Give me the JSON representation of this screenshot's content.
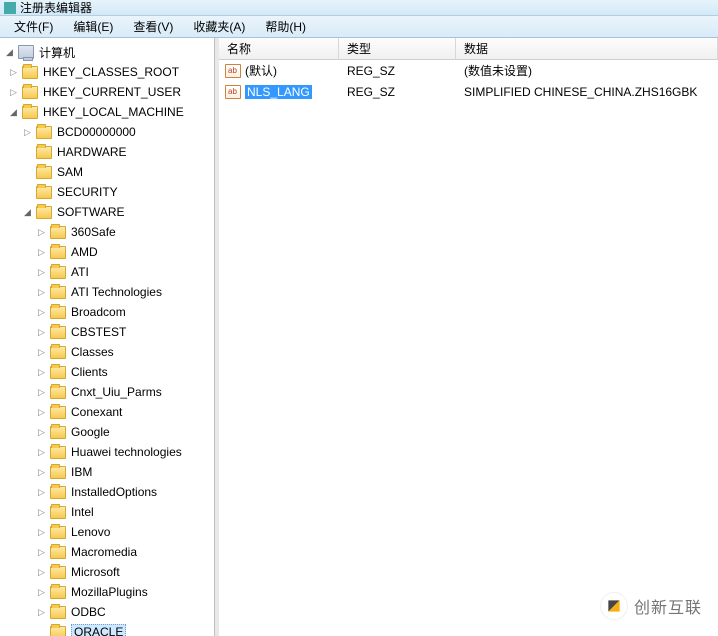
{
  "window": {
    "title": "注册表编辑器"
  },
  "menu": {
    "file": "文件(F)",
    "edit": "编辑(E)",
    "view": "查看(V)",
    "favorites": "收藏夹(A)",
    "help": "帮助(H)"
  },
  "tree": {
    "root": "计算机",
    "hives": [
      {
        "name": "HKEY_CLASSES_ROOT"
      },
      {
        "name": "HKEY_CURRENT_USER"
      },
      {
        "name": "HKEY_LOCAL_MACHINE",
        "expanded": true,
        "children": [
          {
            "name": "BCD00000000"
          },
          {
            "name": "HARDWARE"
          },
          {
            "name": "SAM"
          },
          {
            "name": "SECURITY"
          },
          {
            "name": "SOFTWARE",
            "expanded": true,
            "children": [
              {
                "name": "360Safe"
              },
              {
                "name": "AMD"
              },
              {
                "name": "ATI"
              },
              {
                "name": "ATI Technologies"
              },
              {
                "name": "Broadcom"
              },
              {
                "name": "CBSTEST"
              },
              {
                "name": "Classes"
              },
              {
                "name": "Clients"
              },
              {
                "name": "Cnxt_Uiu_Parms"
              },
              {
                "name": "Conexant"
              },
              {
                "name": "Google"
              },
              {
                "name": "Huawei technologies"
              },
              {
                "name": "IBM"
              },
              {
                "name": "InstalledOptions"
              },
              {
                "name": "Intel"
              },
              {
                "name": "Lenovo"
              },
              {
                "name": "Macromedia"
              },
              {
                "name": "Microsoft"
              },
              {
                "name": "MozillaPlugins"
              },
              {
                "name": "ODBC"
              },
              {
                "name": "ORACLE",
                "selected": true
              }
            ]
          }
        ]
      }
    ]
  },
  "list": {
    "headers": {
      "name": "名称",
      "type": "类型",
      "data": "数据"
    },
    "rows": [
      {
        "name": "(默认)",
        "type": "REG_SZ",
        "data": "(数值未设置)",
        "selected": false
      },
      {
        "name": "NLS_LANG",
        "type": "REG_SZ",
        "data": "SIMPLIFIED CHINESE_CHINA.ZHS16GBK",
        "selected": true
      }
    ]
  },
  "watermark": {
    "text": "创新互联"
  }
}
